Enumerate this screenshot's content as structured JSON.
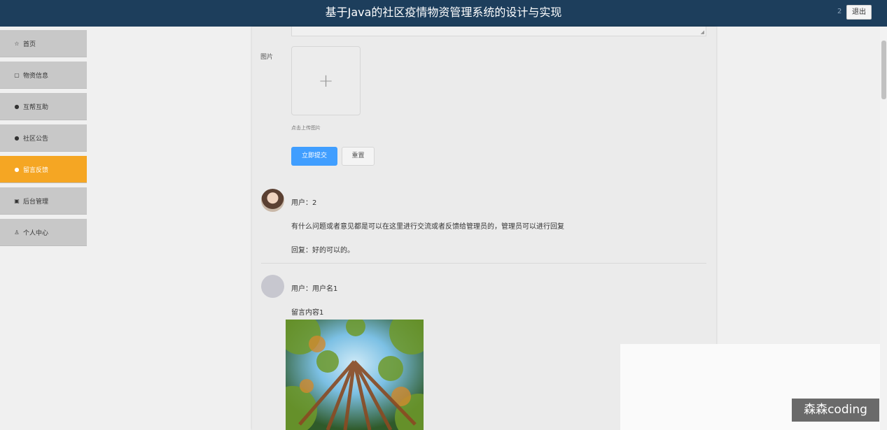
{
  "header": {
    "title": "基于Java的社区疫情物资管理系统的设计与实现",
    "user_number": "2",
    "logout_label": "退出"
  },
  "sidebar": {
    "items": [
      {
        "label": "首页",
        "icon": "star-icon",
        "active": false
      },
      {
        "label": "物资信息",
        "icon": "bag-icon",
        "active": false
      },
      {
        "label": "互帮互助",
        "icon": "info-icon",
        "active": false
      },
      {
        "label": "社区公告",
        "icon": "question-icon",
        "active": false
      },
      {
        "label": "留言反馈",
        "icon": "chat-icon",
        "active": true
      },
      {
        "label": "后台管理",
        "icon": "gift-icon",
        "active": false
      },
      {
        "label": "个人中心",
        "icon": "user-icon",
        "active": false
      }
    ]
  },
  "form": {
    "image_label": "图片",
    "upload_tip": "点击上传图片",
    "submit_label": "立即提交",
    "reset_label": "重置"
  },
  "comments": [
    {
      "user": "用户：2",
      "content": "有什么问题或者意见都是可以在这里进行交流或者反馈给管理员的，管理员可以进行回复",
      "reply": "回复：好的可以的。"
    },
    {
      "user": "用户：用户名1",
      "content": "留言内容1"
    }
  ],
  "colors": {
    "header_bg": "#1d3e5c",
    "nav_active": "#f5a623",
    "primary_button": "#409eff"
  },
  "watermark": "森森coding"
}
